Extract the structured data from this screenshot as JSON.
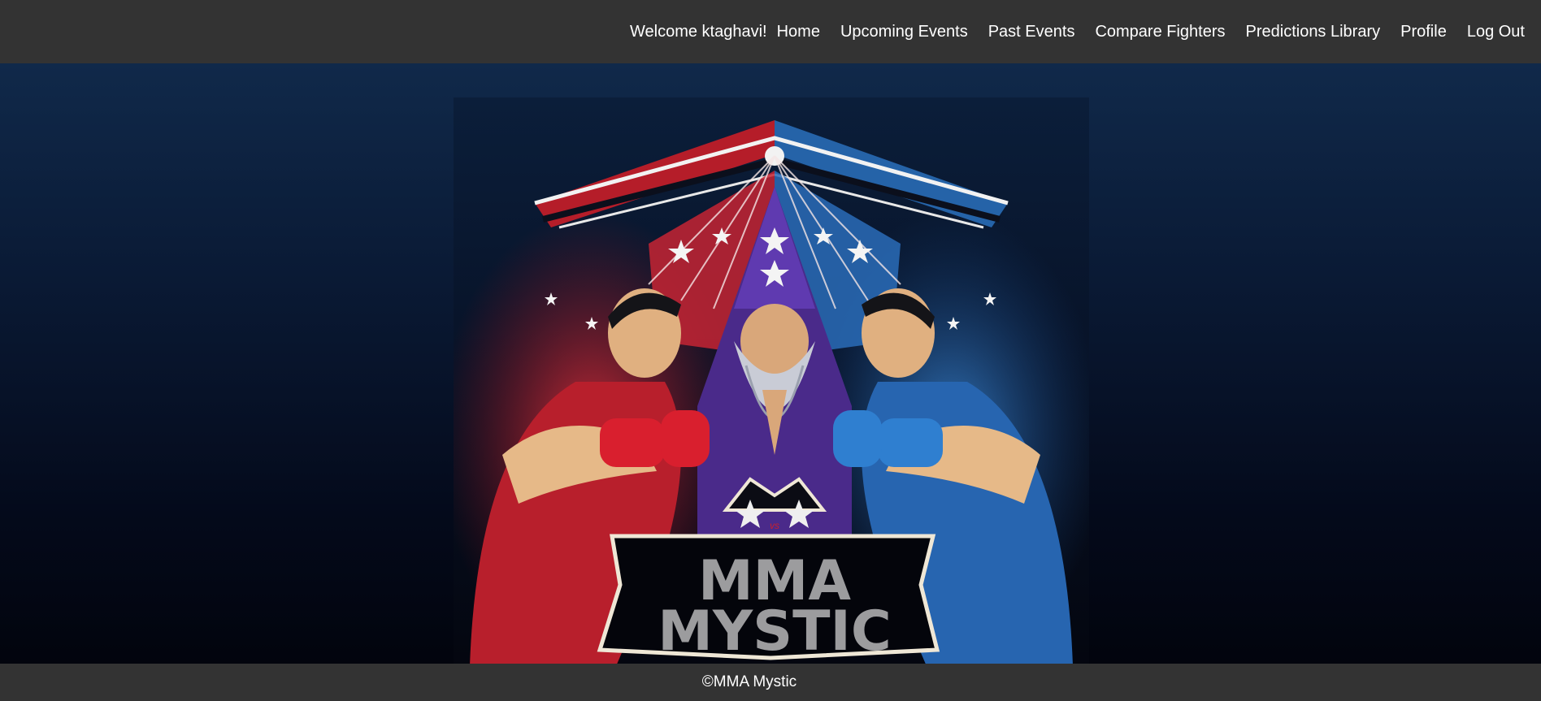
{
  "nav": {
    "welcome": "Welcome ktaghavi!",
    "links": [
      "Home",
      "Upcoming Events",
      "Past Events",
      "Compare Fighters",
      "Predictions Library",
      "Profile",
      "Log Out"
    ]
  },
  "logo": {
    "line1": "MMA",
    "line2": "MYSTIC",
    "badge": "vs"
  },
  "footer": {
    "text": "©MMA Mystic"
  },
  "colors": {
    "navbar": "#333333",
    "red_corner": "#d4202c",
    "blue_corner": "#2f74c4",
    "wizard": "#4a2a8a"
  }
}
